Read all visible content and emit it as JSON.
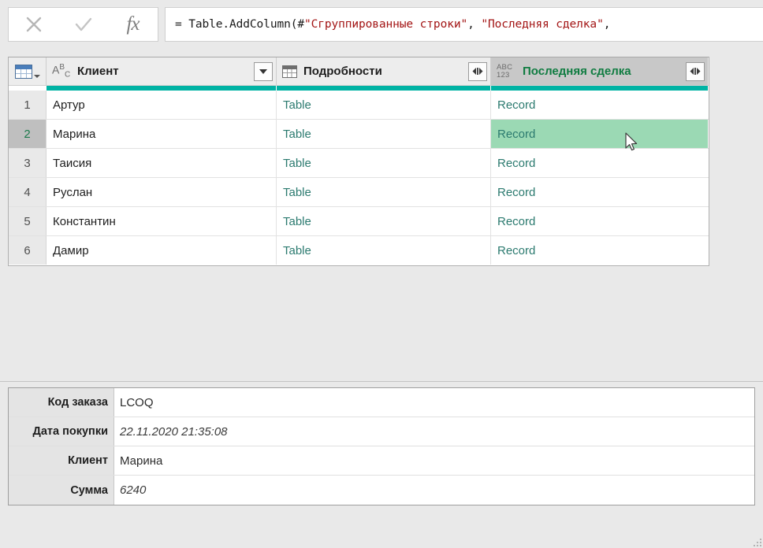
{
  "formula_bar": {
    "cancel_label": "✕",
    "accept_label": "✓",
    "fx_label": "fx",
    "formula_prefix": "= Table.AddColumn(#",
    "formula_arg1": "\"Сгруппированные строки\"",
    "formula_sep": ", ",
    "formula_arg2": "\"Последняя сделка\"",
    "formula_tail": ",",
    "formula_full": "= Table.AddColumn(#\"Сгруппированные строки\", \"Последняя сделка\","
  },
  "grid": {
    "corner_icon": "table-select-all-icon",
    "columns": [
      {
        "name": "Клиент",
        "type_icon": "ABC",
        "type_icon_name": "text-type-icon",
        "has_filter": true,
        "has_expand": false,
        "selected": false
      },
      {
        "name": "Подробности",
        "type_icon": "table",
        "type_icon_name": "table-type-icon",
        "has_filter": false,
        "has_expand": true,
        "selected": false
      },
      {
        "name": "Последняя сделка",
        "type_icon": "ABC123",
        "type_icon_name": "any-type-icon",
        "has_filter": false,
        "has_expand": true,
        "selected": true
      }
    ],
    "rows": [
      {
        "num": "1",
        "client": "Артур",
        "details": "Table",
        "last_deal": "Record",
        "selected": false,
        "highlight": false
      },
      {
        "num": "2",
        "client": "Марина",
        "details": "Table",
        "last_deal": "Record",
        "selected": true,
        "highlight": true
      },
      {
        "num": "3",
        "client": "Таисия",
        "details": "Table",
        "last_deal": "Record",
        "selected": false,
        "highlight": false
      },
      {
        "num": "4",
        "client": "Руслан",
        "details": "Table",
        "last_deal": "Record",
        "selected": false,
        "highlight": false
      },
      {
        "num": "5",
        "client": "Константин",
        "details": "Table",
        "last_deal": "Record",
        "selected": false,
        "highlight": false
      },
      {
        "num": "6",
        "client": "Дамир",
        "details": "Table",
        "last_deal": "Record",
        "selected": false,
        "highlight": false
      }
    ]
  },
  "detail_panel": {
    "rows": [
      {
        "label": "Код заказа",
        "value": "LCOQ",
        "italic": false
      },
      {
        "label": "Дата покупки",
        "value": "22.11.2020 21:35:08",
        "italic": true
      },
      {
        "label": "Клиент",
        "value": "Марина",
        "italic": false
      },
      {
        "label": "Сумма",
        "value": "6240",
        "italic": true
      }
    ]
  },
  "colors": {
    "accent_teal": "#00B3A4",
    "selection_green": "#9BD9B4",
    "header_green_text": "#107C41",
    "link_teal_text": "#2b7a6f",
    "string_red": "#a31515",
    "chrome_gray": "#e9e9e9",
    "selected_header_gray": "#c8c8c8"
  }
}
